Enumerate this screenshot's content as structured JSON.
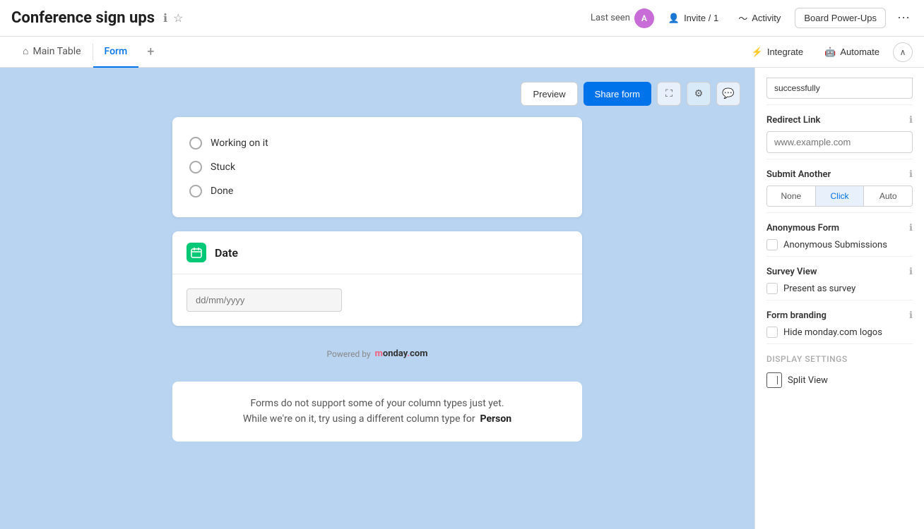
{
  "header": {
    "title": "Conference sign ups",
    "last_seen_label": "Last seen",
    "invite_label": "Invite / 1",
    "activity_label": "Activity",
    "board_powerups_label": "Board Power-Ups",
    "more_icon": "⋯"
  },
  "tabs": {
    "main_table_label": "Main Table",
    "form_label": "Form",
    "add_icon": "+"
  },
  "tab_bar_actions": {
    "integrate_label": "Integrate",
    "automate_label": "Automate",
    "collapse_icon": "∧"
  },
  "toolbar": {
    "preview_label": "Preview",
    "share_form_label": "Share form",
    "expand_icon": "⛶",
    "settings_icon": "⚙",
    "feedback_icon": "💬"
  },
  "form": {
    "radio_options": [
      {
        "label": "Working on it"
      },
      {
        "label": "Stuck"
      },
      {
        "label": "Done"
      }
    ],
    "date_icon": "▦",
    "date_label": "Date",
    "date_placeholder": "dd/mm/yyyy",
    "powered_by": "Powered by",
    "monday_logo": "monday.com",
    "unsupported_line1": "Forms do not support some of your column types just yet.",
    "unsupported_line2": "While we're on it, try using a different column type for",
    "unsupported_person": "Person"
  },
  "right_panel": {
    "redirect_link_title": "Redirect Link",
    "redirect_placeholder": "www.example.com",
    "success_text_partial": "successfully",
    "submit_another_title": "Submit Another",
    "submit_options": [
      {
        "label": "None",
        "active": false
      },
      {
        "label": "Click",
        "active": true
      },
      {
        "label": "Auto",
        "active": false
      }
    ],
    "anonymous_form_title": "Anonymous Form",
    "anonymous_submissions_label": "Anonymous Submissions",
    "survey_view_title": "Survey View",
    "present_as_survey_label": "Present as survey",
    "form_branding_title": "Form branding",
    "hide_logos_label": "Hide monday.com logos",
    "display_settings_title": "Display Settings",
    "split_view_label": "Split View"
  }
}
